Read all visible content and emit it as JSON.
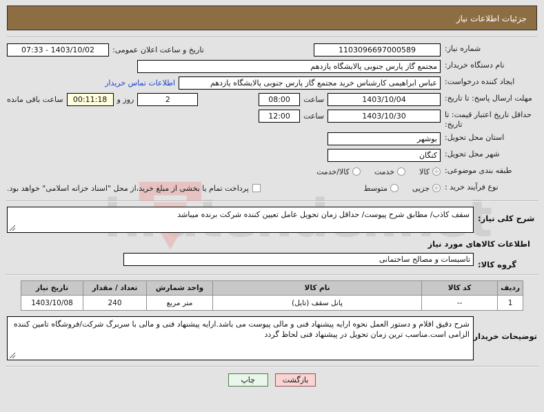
{
  "header": {
    "title": "جزئیات اطلاعات نیاز",
    "bar_color": "#8d6e42"
  },
  "form": {
    "need_number": {
      "label": "شماره نیاز:",
      "value": "1103096697000589"
    },
    "public_announce": {
      "label": "تاریخ و ساعت اعلان عمومی:",
      "value": "1403/10/02 - 07:33"
    },
    "buyer_org": {
      "label": "نام دستگاه خریدار:",
      "value": "مجتمع گاز پارس جنوبی  پالایشگاه یازدهم"
    },
    "request_creator": {
      "label": "ایجاد کننده درخواست:",
      "value": "عباس ابراهیمی کارشناس خرید مجتمع گاز پارس جنوبی  پالایشگاه یازدهم",
      "contact_link": "اطلاعات تماس خریدار"
    },
    "response_deadline": {
      "label": "مهلت ارسال پاسخ: تا تاریخ:",
      "date": "1403/10/04",
      "time_label": "ساعت",
      "time": "08:00",
      "days_value": "2",
      "days_label": "روز و",
      "countdown": "00:11:18",
      "remaining_label": "ساعت باقی مانده"
    },
    "price_validity": {
      "label": "حداقل تاریخ اعتبار قیمت: تا تاریخ:",
      "date": "1403/10/30",
      "time_label": "ساعت",
      "time": "12:00"
    },
    "delivery_province": {
      "label": "استان محل تحویل:",
      "value": "بوشهر"
    },
    "delivery_city": {
      "label": "شهر محل تحویل:",
      "value": "کنگان"
    },
    "subject_category": {
      "label": "طبقه بندی موضوعی:",
      "options": [
        "کالا",
        "خدمت",
        "کالا/خدمت"
      ],
      "selected_index": 0
    },
    "purchase_process": {
      "label": "نوع فرآیند خرید :",
      "options": [
        "جزیی",
        "متوسط"
      ],
      "selected_index": 0,
      "checkbox_label": "پرداخت تمام یا بخشی از مبلغ خرید،از محل \"اسناد خزانه اسلامی\" خواهد بود.",
      "checkbox_checked": false
    }
  },
  "general_need": {
    "label": "شرح کلی نیاز:",
    "value": "سقف کاذب/ مطابق شرح پیوست/ حداقل زمان تحویل عامل تعیین کننده شرکت برنده میباشد"
  },
  "goods_section": {
    "title": "اطلاعات کالاهای مورد نیاز",
    "group_label": "گروه کالا:",
    "group_value": "تاسیسات و مصالح ساختمانی",
    "columns": [
      "ردیف",
      "کد کالا",
      "نام کالا",
      "واحد شمارش",
      "تعداد / مقدار",
      "تاریخ نیاز"
    ],
    "rows": [
      {
        "radif": "1",
        "code": "--",
        "name": "پانل سقف (تایل)",
        "unit": "متر مربع",
        "qty": "240",
        "date": "1403/10/08"
      }
    ]
  },
  "buyer_notes": {
    "label": "توضیحات خریدار:",
    "value": "شرح دقیق اقلام و دستور العمل نحوه ارایه پیشنهاد فنی و مالی پیوست می باشد.ارایه پیشنهاد فنی و مالی با سربرگ شرکت/فروشگاه تامین کننده الزامی است.مناسب ترین زمان تحویل در پیشنهاد فنی لحاظ گردد"
  },
  "footer": {
    "print_label": "چاپ",
    "back_label": "بازگشت"
  },
  "watermark": {
    "text": "hratender.net"
  }
}
